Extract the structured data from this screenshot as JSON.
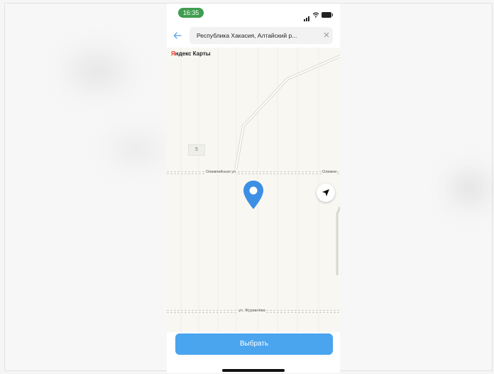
{
  "status_bar": {
    "time": "16:35",
    "battery": "60"
  },
  "search": {
    "back_icon": "arrow-left-icon",
    "value": "Республика Хакасия, Алтайский р...",
    "clear_icon": "close-icon"
  },
  "map": {
    "logo_first": "Я",
    "logo_rest": "ндекс Карты",
    "house_number": "5",
    "street_top_left": "Олимпийская ул.",
    "street_top_right": "Олимпи",
    "street_bottom": "ул. Журавлёва",
    "locate_icon": "navigation-arrow-icon",
    "pin_icon": "location-pin-icon"
  },
  "actions": {
    "select_label": "Выбрать"
  },
  "colors": {
    "accent": "#4aa4ee",
    "pin": "#3d8fe4",
    "status_pill": "#3f9e4f",
    "logo_red": "#e5332a"
  }
}
